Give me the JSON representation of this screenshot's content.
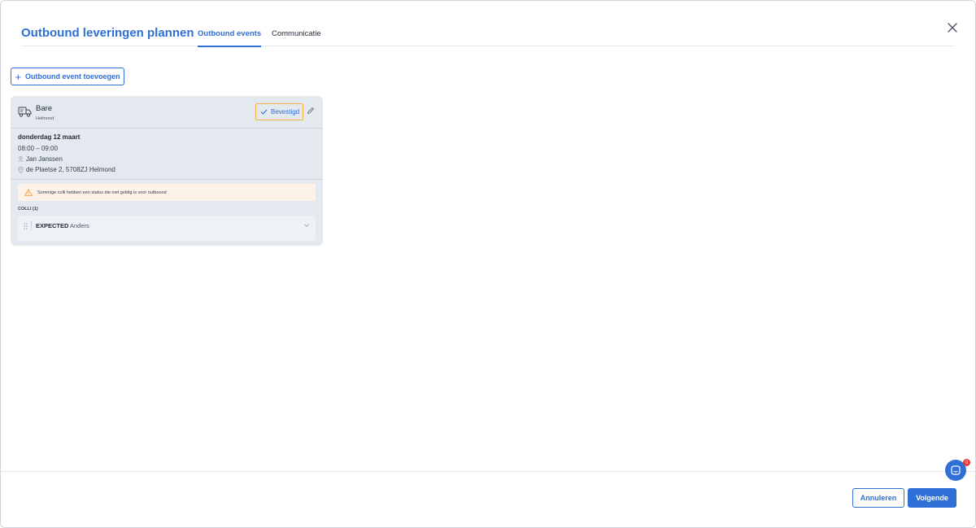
{
  "header": {
    "title": "Outbound leveringen plannen",
    "tabs": [
      {
        "label": "Outbound events",
        "active": true
      },
      {
        "label": "Communicatie",
        "active": false
      }
    ]
  },
  "actions": {
    "add_event_label": "Outbound event toevoegen"
  },
  "event_card": {
    "carrier": "Bare",
    "carrier_location": "Helmond",
    "status_label": "Bevestigd",
    "date": "donderdag 12 maart",
    "time_window": "08:00 – 09:00",
    "contact_name": "Jan Janssen",
    "address": "de Plaetse 2, 5708ZJ Helmond",
    "warning": "Sommige colli hebben een status die niet geldig is voor outbound",
    "colli_label": "COLLI (1)",
    "colli": [
      {
        "status": "EXPECTED",
        "type": "Anders"
      }
    ]
  },
  "chat": {
    "badge_count": "0"
  },
  "footer": {
    "cancel_label": "Annuleren",
    "next_label": "Volgende"
  },
  "colors": {
    "accent": "#2f6fd6",
    "warning_bg": "#fdf2e7",
    "warning_icon": "#f0a030",
    "badge_border": "#f0b44a",
    "card_bg": "#e4e9f0"
  }
}
